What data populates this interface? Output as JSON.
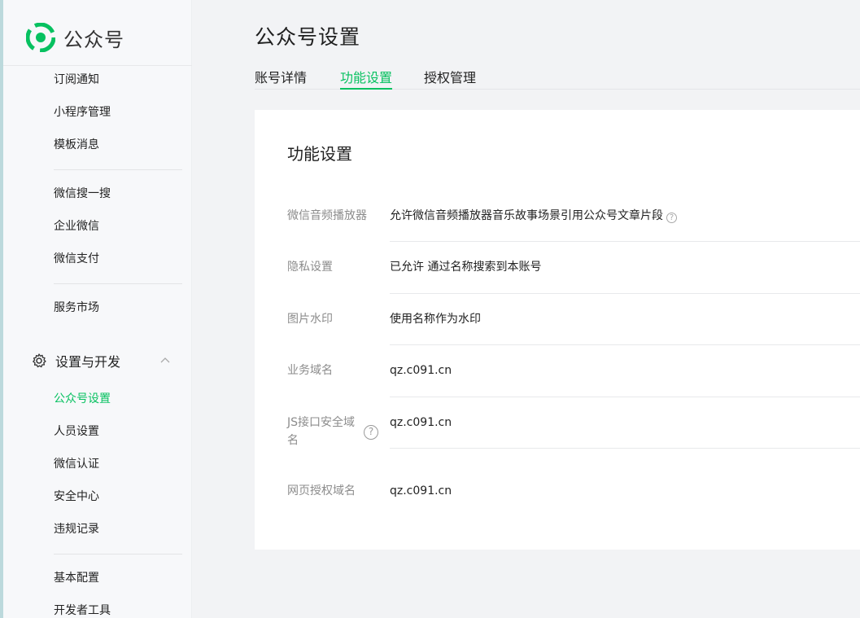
{
  "brand": {
    "name": "公众号",
    "color": "#07c160"
  },
  "sidebar": {
    "items": [
      {
        "label": "订阅通知"
      },
      {
        "label": "小程序管理"
      },
      {
        "label": "模板消息"
      },
      {
        "label": "微信搜一搜"
      },
      {
        "label": "企业微信"
      },
      {
        "label": "微信支付"
      },
      {
        "label": "服务市场"
      },
      {
        "label": "公众号设置",
        "active": true
      },
      {
        "label": "人员设置"
      },
      {
        "label": "微信认证"
      },
      {
        "label": "安全中心"
      },
      {
        "label": "违规记录"
      },
      {
        "label": "基本配置"
      },
      {
        "label": "开发者工具"
      }
    ],
    "group": {
      "label": "设置与开发",
      "icon": "gear-icon",
      "expanded": true
    }
  },
  "page": {
    "title": "公众号设置"
  },
  "tabs": [
    {
      "label": "账号详情"
    },
    {
      "label": "功能设置",
      "active": true
    },
    {
      "label": "授权管理"
    }
  ],
  "card": {
    "title": "功能设置",
    "rows": [
      {
        "label": "微信音频播放器",
        "value": "允许微信音频播放器音乐故事场景引用公众号文章片段",
        "help": "?"
      },
      {
        "label": "隐私设置",
        "value": "已允许 通过名称搜索到本账号"
      },
      {
        "label": "图片水印",
        "value": "使用名称作为水印"
      },
      {
        "label": "业务域名",
        "value": "qz.c091.cn"
      },
      {
        "label_line1": "JS接口安全域",
        "label_line2": "名",
        "value": "qz.c091.cn",
        "help": "?"
      },
      {
        "label": "网页授权域名",
        "value": "qz.c091.cn"
      }
    ]
  }
}
